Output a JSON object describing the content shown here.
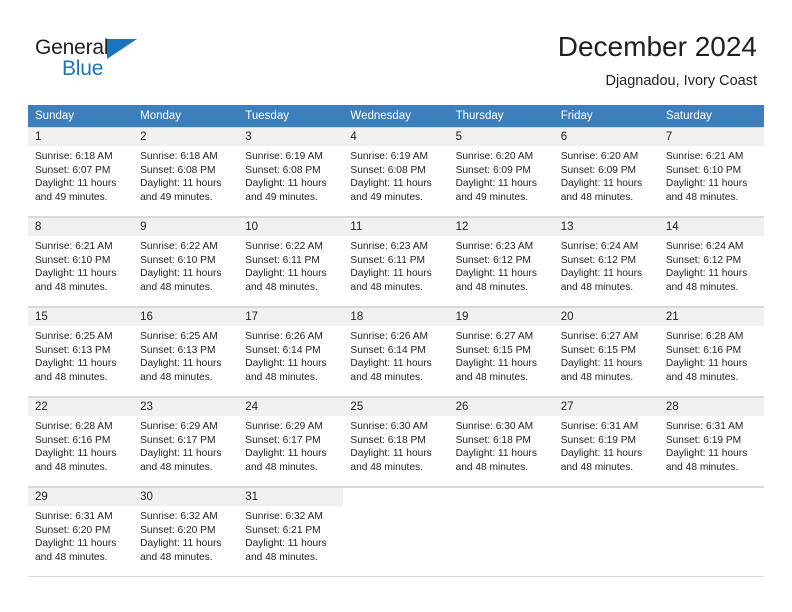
{
  "brand": {
    "name_part1": "General",
    "name_part2": "Blue",
    "triangle_color": "#1b75bb"
  },
  "header": {
    "title": "December 2024",
    "subtitle": "Djagnadou, Ivory Coast"
  },
  "theme": {
    "header_row_bg": "#3d7ebd",
    "daynum_bg": "#f0f0f0",
    "border": "#d9d9d9",
    "text": "#231f20"
  },
  "weekday_headers": [
    "Sunday",
    "Monday",
    "Tuesday",
    "Wednesday",
    "Thursday",
    "Friday",
    "Saturday"
  ],
  "weeks": [
    [
      {
        "day": "1",
        "sunrise": "Sunrise: 6:18 AM",
        "sunset": "Sunset: 6:07 PM",
        "daylight_line1": "Daylight: 11 hours",
        "daylight_line2": "and 49 minutes."
      },
      {
        "day": "2",
        "sunrise": "Sunrise: 6:18 AM",
        "sunset": "Sunset: 6:08 PM",
        "daylight_line1": "Daylight: 11 hours",
        "daylight_line2": "and 49 minutes."
      },
      {
        "day": "3",
        "sunrise": "Sunrise: 6:19 AM",
        "sunset": "Sunset: 6:08 PM",
        "daylight_line1": "Daylight: 11 hours",
        "daylight_line2": "and 49 minutes."
      },
      {
        "day": "4",
        "sunrise": "Sunrise: 6:19 AM",
        "sunset": "Sunset: 6:08 PM",
        "daylight_line1": "Daylight: 11 hours",
        "daylight_line2": "and 49 minutes."
      },
      {
        "day": "5",
        "sunrise": "Sunrise: 6:20 AM",
        "sunset": "Sunset: 6:09 PM",
        "daylight_line1": "Daylight: 11 hours",
        "daylight_line2": "and 49 minutes."
      },
      {
        "day": "6",
        "sunrise": "Sunrise: 6:20 AM",
        "sunset": "Sunset: 6:09 PM",
        "daylight_line1": "Daylight: 11 hours",
        "daylight_line2": "and 48 minutes."
      },
      {
        "day": "7",
        "sunrise": "Sunrise: 6:21 AM",
        "sunset": "Sunset: 6:10 PM",
        "daylight_line1": "Daylight: 11 hours",
        "daylight_line2": "and 48 minutes."
      }
    ],
    [
      {
        "day": "8",
        "sunrise": "Sunrise: 6:21 AM",
        "sunset": "Sunset: 6:10 PM",
        "daylight_line1": "Daylight: 11 hours",
        "daylight_line2": "and 48 minutes."
      },
      {
        "day": "9",
        "sunrise": "Sunrise: 6:22 AM",
        "sunset": "Sunset: 6:10 PM",
        "daylight_line1": "Daylight: 11 hours",
        "daylight_line2": "and 48 minutes."
      },
      {
        "day": "10",
        "sunrise": "Sunrise: 6:22 AM",
        "sunset": "Sunset: 6:11 PM",
        "daylight_line1": "Daylight: 11 hours",
        "daylight_line2": "and 48 minutes."
      },
      {
        "day": "11",
        "sunrise": "Sunrise: 6:23 AM",
        "sunset": "Sunset: 6:11 PM",
        "daylight_line1": "Daylight: 11 hours",
        "daylight_line2": "and 48 minutes."
      },
      {
        "day": "12",
        "sunrise": "Sunrise: 6:23 AM",
        "sunset": "Sunset: 6:12 PM",
        "daylight_line1": "Daylight: 11 hours",
        "daylight_line2": "and 48 minutes."
      },
      {
        "day": "13",
        "sunrise": "Sunrise: 6:24 AM",
        "sunset": "Sunset: 6:12 PM",
        "daylight_line1": "Daylight: 11 hours",
        "daylight_line2": "and 48 minutes."
      },
      {
        "day": "14",
        "sunrise": "Sunrise: 6:24 AM",
        "sunset": "Sunset: 6:12 PM",
        "daylight_line1": "Daylight: 11 hours",
        "daylight_line2": "and 48 minutes."
      }
    ],
    [
      {
        "day": "15",
        "sunrise": "Sunrise: 6:25 AM",
        "sunset": "Sunset: 6:13 PM",
        "daylight_line1": "Daylight: 11 hours",
        "daylight_line2": "and 48 minutes."
      },
      {
        "day": "16",
        "sunrise": "Sunrise: 6:25 AM",
        "sunset": "Sunset: 6:13 PM",
        "daylight_line1": "Daylight: 11 hours",
        "daylight_line2": "and 48 minutes."
      },
      {
        "day": "17",
        "sunrise": "Sunrise: 6:26 AM",
        "sunset": "Sunset: 6:14 PM",
        "daylight_line1": "Daylight: 11 hours",
        "daylight_line2": "and 48 minutes."
      },
      {
        "day": "18",
        "sunrise": "Sunrise: 6:26 AM",
        "sunset": "Sunset: 6:14 PM",
        "daylight_line1": "Daylight: 11 hours",
        "daylight_line2": "and 48 minutes."
      },
      {
        "day": "19",
        "sunrise": "Sunrise: 6:27 AM",
        "sunset": "Sunset: 6:15 PM",
        "daylight_line1": "Daylight: 11 hours",
        "daylight_line2": "and 48 minutes."
      },
      {
        "day": "20",
        "sunrise": "Sunrise: 6:27 AM",
        "sunset": "Sunset: 6:15 PM",
        "daylight_line1": "Daylight: 11 hours",
        "daylight_line2": "and 48 minutes."
      },
      {
        "day": "21",
        "sunrise": "Sunrise: 6:28 AM",
        "sunset": "Sunset: 6:16 PM",
        "daylight_line1": "Daylight: 11 hours",
        "daylight_line2": "and 48 minutes."
      }
    ],
    [
      {
        "day": "22",
        "sunrise": "Sunrise: 6:28 AM",
        "sunset": "Sunset: 6:16 PM",
        "daylight_line1": "Daylight: 11 hours",
        "daylight_line2": "and 48 minutes."
      },
      {
        "day": "23",
        "sunrise": "Sunrise: 6:29 AM",
        "sunset": "Sunset: 6:17 PM",
        "daylight_line1": "Daylight: 11 hours",
        "daylight_line2": "and 48 minutes."
      },
      {
        "day": "24",
        "sunrise": "Sunrise: 6:29 AM",
        "sunset": "Sunset: 6:17 PM",
        "daylight_line1": "Daylight: 11 hours",
        "daylight_line2": "and 48 minutes."
      },
      {
        "day": "25",
        "sunrise": "Sunrise: 6:30 AM",
        "sunset": "Sunset: 6:18 PM",
        "daylight_line1": "Daylight: 11 hours",
        "daylight_line2": "and 48 minutes."
      },
      {
        "day": "26",
        "sunrise": "Sunrise: 6:30 AM",
        "sunset": "Sunset: 6:18 PM",
        "daylight_line1": "Daylight: 11 hours",
        "daylight_line2": "and 48 minutes."
      },
      {
        "day": "27",
        "sunrise": "Sunrise: 6:31 AM",
        "sunset": "Sunset: 6:19 PM",
        "daylight_line1": "Daylight: 11 hours",
        "daylight_line2": "and 48 minutes."
      },
      {
        "day": "28",
        "sunrise": "Sunrise: 6:31 AM",
        "sunset": "Sunset: 6:19 PM",
        "daylight_line1": "Daylight: 11 hours",
        "daylight_line2": "and 48 minutes."
      }
    ],
    [
      {
        "day": "29",
        "sunrise": "Sunrise: 6:31 AM",
        "sunset": "Sunset: 6:20 PM",
        "daylight_line1": "Daylight: 11 hours",
        "daylight_line2": "and 48 minutes."
      },
      {
        "day": "30",
        "sunrise": "Sunrise: 6:32 AM",
        "sunset": "Sunset: 6:20 PM",
        "daylight_line1": "Daylight: 11 hours",
        "daylight_line2": "and 48 minutes."
      },
      {
        "day": "31",
        "sunrise": "Sunrise: 6:32 AM",
        "sunset": "Sunset: 6:21 PM",
        "daylight_line1": "Daylight: 11 hours",
        "daylight_line2": "and 48 minutes."
      },
      {
        "day": "",
        "sunrise": "",
        "sunset": "",
        "daylight_line1": "",
        "daylight_line2": ""
      },
      {
        "day": "",
        "sunrise": "",
        "sunset": "",
        "daylight_line1": "",
        "daylight_line2": ""
      },
      {
        "day": "",
        "sunrise": "",
        "sunset": "",
        "daylight_line1": "",
        "daylight_line2": ""
      },
      {
        "day": "",
        "sunrise": "",
        "sunset": "",
        "daylight_line1": "",
        "daylight_line2": ""
      }
    ]
  ]
}
